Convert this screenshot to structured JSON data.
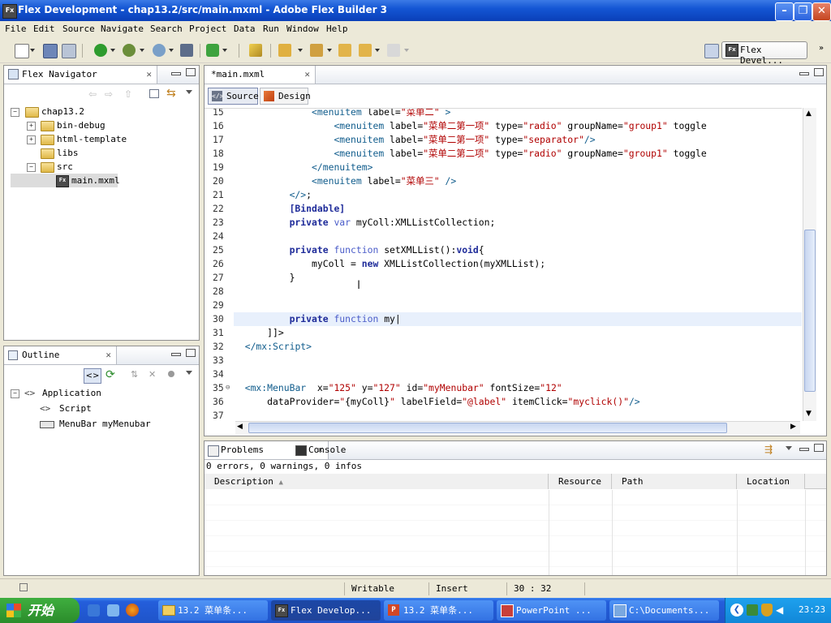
{
  "window": {
    "title": "Flex Development - chap13.2/src/main.mxml - Adobe Flex Builder 3",
    "app_icon": "Fx"
  },
  "menu": [
    "File",
    "Edit",
    "Source",
    "Navigate",
    "Search",
    "Project",
    "Data",
    "Run",
    "Window",
    "Help"
  ],
  "perspective": {
    "label": "Flex Devel..."
  },
  "navigator": {
    "title": "Flex Navigator",
    "tree": [
      {
        "label": "chap13.2",
        "level": 0,
        "expander": "−"
      },
      {
        "label": "bin-debug",
        "level": 1,
        "expander": "+"
      },
      {
        "label": "html-template",
        "level": 1,
        "expander": "+"
      },
      {
        "label": "libs",
        "level": 1,
        "expander": ""
      },
      {
        "label": "src",
        "level": 1,
        "expander": "−"
      },
      {
        "label": "main.mxml",
        "level": 2,
        "expander": ""
      }
    ]
  },
  "outline": {
    "title": "Outline",
    "tree": [
      {
        "label": "Application",
        "level": 0
      },
      {
        "label": "Script",
        "level": 1
      },
      {
        "label": "MenuBar myMenubar",
        "level": 1
      }
    ]
  },
  "editor": {
    "tab": "*main.mxml",
    "source_label": "Source",
    "design_label": "Design",
    "lines": [
      {
        "n": "15",
        "html": "<span class='plain'>              </span><span class='tagc'>&lt;menuitem</span> <span class='attr'>label=</span><span class='str'>\"菜单二\"</span> <span class='tagc'>&gt;</span>"
      },
      {
        "n": "16",
        "html": "<span class='plain'>                  </span><span class='tagc'>&lt;menuitem</span> <span class='attr'>label=</span><span class='str'>\"菜单二第一项\"</span> <span class='attr'>type=</span><span class='str'>\"radio\"</span> <span class='attr'>groupName=</span><span class='str'>\"group1\"</span> <span class='attr'>toggle</span>"
      },
      {
        "n": "17",
        "html": "<span class='plain'>                  </span><span class='tagc'>&lt;menuitem</span> <span class='attr'>label=</span><span class='str'>\"菜单二第一项\"</span> <span class='attr'>type=</span><span class='str'>\"separator\"</span><span class='tagc'>/&gt;</span>"
      },
      {
        "n": "18",
        "html": "<span class='plain'>                  </span><span class='tagc'>&lt;menuitem</span> <span class='attr'>label=</span><span class='str'>\"菜单二第二项\"</span> <span class='attr'>type=</span><span class='str'>\"radio\"</span> <span class='attr'>groupName=</span><span class='str'>\"group1\"</span> <span class='attr'>toggle</span>"
      },
      {
        "n": "19",
        "html": "<span class='plain'>              </span><span class='tagc'>&lt;/menuitem&gt;</span>"
      },
      {
        "n": "20",
        "html": "<span class='plain'>              </span><span class='tagc'>&lt;menuitem</span> <span class='attr'>label=</span><span class='str'>\"菜单三\"</span> <span class='tagc'>/&gt;</span>"
      },
      {
        "n": "21",
        "html": "<span class='plain'>          </span><span class='tagc'>&lt;/&gt;</span><span class='plain'>;</span>"
      },
      {
        "n": "22",
        "html": "<span class='plain'>          </span><span class='kw'>[Bindable]</span>"
      },
      {
        "n": "23",
        "html": "<span class='plain'>          </span><span class='kw'>private</span> <span class='kw' style='font-weight:normal;color:#4a5cc9'>var</span> <span class='plain'>myColl:XMLListCollection;</span>"
      },
      {
        "n": "24",
        "html": ""
      },
      {
        "n": "25",
        "html": "<span class='plain'>          </span><span class='kw'>private</span> <span class='kw' style='font-weight:normal;color:#4a5cc9'>function</span> <span class='plain'>setXMLList():</span><span class='kw'>void</span><span class='plain'>{</span>"
      },
      {
        "n": "26",
        "html": "<span class='plain'>              myColl = </span><span class='kw'>new</span> <span class='plain'>XMLListCollection(myXMLList);</span>"
      },
      {
        "n": "27",
        "html": "<span class='plain'>          }</span>"
      },
      {
        "n": "28",
        "html": ""
      },
      {
        "n": "29",
        "html": ""
      },
      {
        "n": "30",
        "html": "<span class='plain'>          </span><span class='kw'>private</span> <span class='kw' style='font-weight:normal;color:#4a5cc9'>function</span> <span class='plain'>my|</span>"
      },
      {
        "n": "31",
        "html": "<span class='plain'>      ]]&gt;</span>"
      },
      {
        "n": "32",
        "html": "<span class='plain'>  </span><span class='tagc'>&lt;/mx:Script&gt;</span>"
      },
      {
        "n": "33",
        "html": ""
      },
      {
        "n": "34",
        "html": ""
      },
      {
        "n": "35",
        "html": "<span class='plain'>  </span><span class='tagc'>&lt;mx:MenuBar</span>  <span class='attr'>x=</span><span class='str'>\"125\"</span> <span class='attr'>y=</span><span class='str'>\"127\"</span> <span class='attr'>id=</span><span class='str'>\"myMenubar\"</span> <span class='attr'>fontSize=</span><span class='str'>\"12\"</span>"
      },
      {
        "n": "36",
        "html": "<span class='plain'>      </span><span class='attr'>dataProvider=</span><span class='str'>\"</span><span class='plain'>{myColl}</span><span class='str'>\"</span> <span class='attr'>labelField=</span><span class='str'>\"@label\"</span> <span class='attr'>itemClick=</span><span class='str'>\"myclick()\"</span><span class='tagc'>/&gt;</span>"
      },
      {
        "n": "37",
        "html": ""
      }
    ]
  },
  "problems": {
    "tab": "Problems",
    "console_tab": "Console",
    "summary": "0 errors, 0 warnings, 0 infos",
    "columns": [
      "Description",
      "Resource",
      "Path",
      "Location"
    ]
  },
  "status": {
    "writable": "Writable",
    "insert": "Insert",
    "position": "30 : 32"
  },
  "taskbar": {
    "start": "开始",
    "tasks": [
      "13.2 菜单条...",
      "Flex Develop...",
      "13.2 菜单条...",
      "PowerPoint ...",
      "C:\\Documents..."
    ],
    "clock": "23:23"
  },
  "colors": {
    "title_blue": "#1456d4",
    "taskbar_blue": "#245edb",
    "start_green": "#2b8c2b"
  }
}
